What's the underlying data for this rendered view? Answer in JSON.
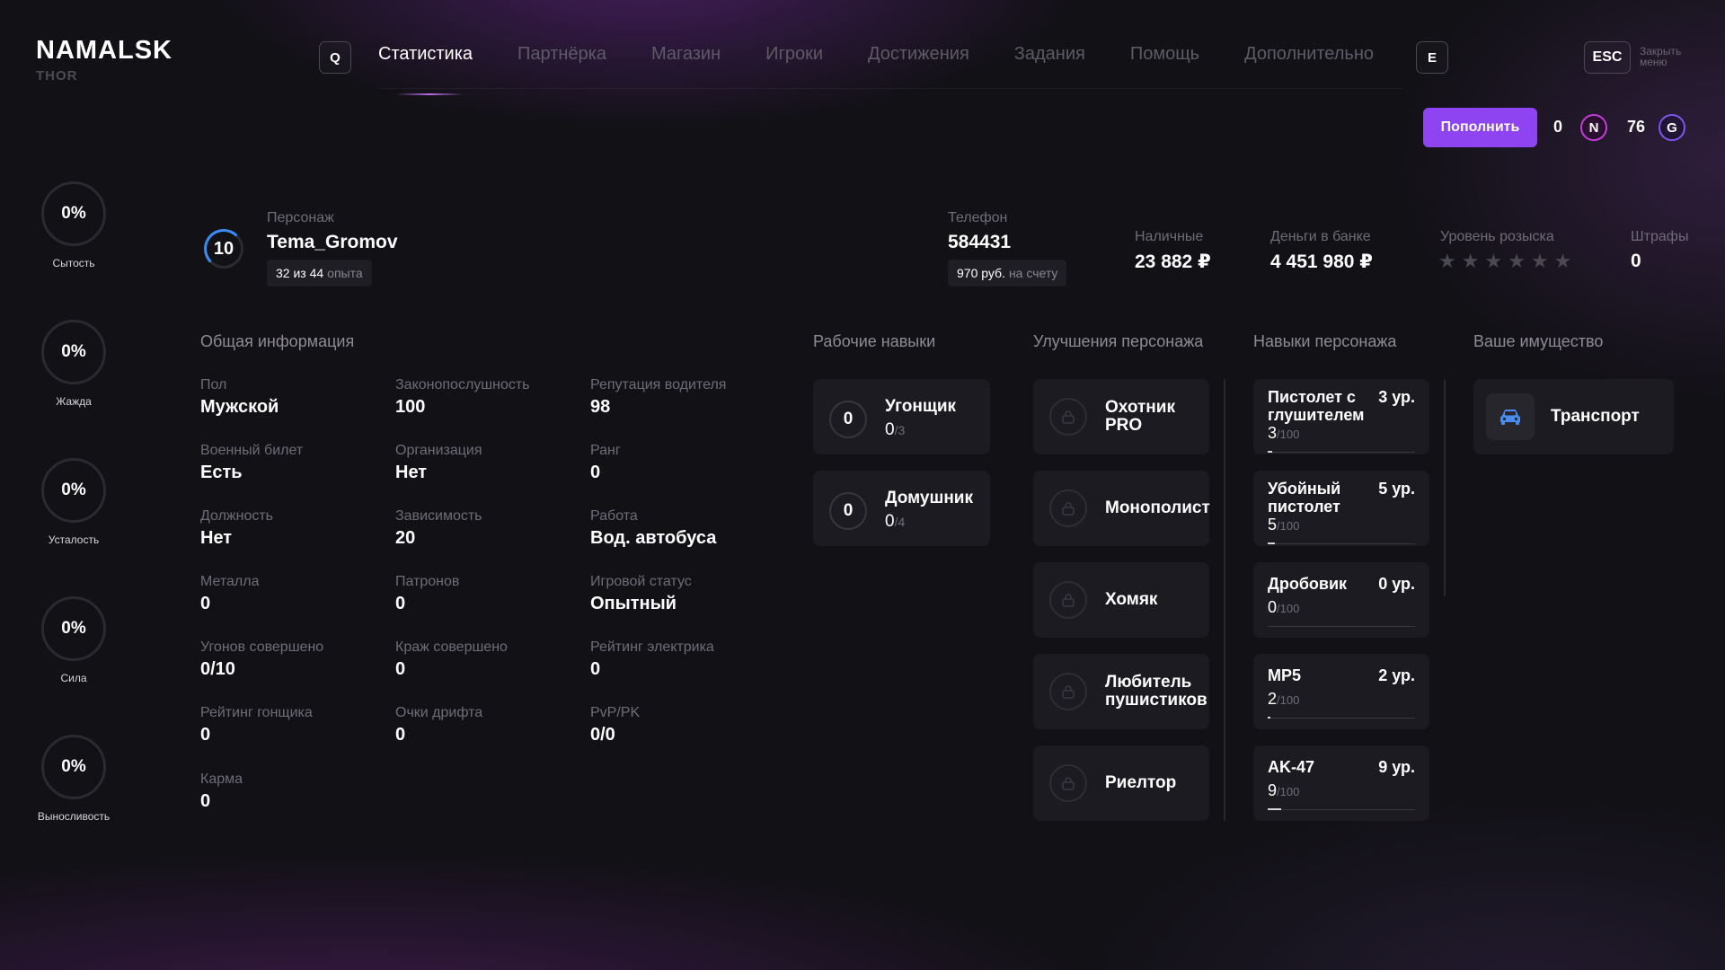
{
  "brand": {
    "title": "NAMALSK",
    "subtitle": "THOR"
  },
  "hotkeys": {
    "left": "Q",
    "right": "E",
    "esc": "ESC",
    "close_menu": "Закрыть меню"
  },
  "nav": [
    "Статистика",
    "Партнёрка",
    "Магазин",
    "Игроки",
    "Достижения",
    "Задания",
    "Помощь",
    "Дополнительно"
  ],
  "nav_active": 0,
  "wallet": {
    "topup_label": "Пополнить",
    "n_amount": "0",
    "n_symbol": "N",
    "g_amount": "76",
    "g_symbol": "G"
  },
  "needs": [
    {
      "value": "0%",
      "label": "Сытость"
    },
    {
      "value": "0%",
      "label": "Жажда"
    },
    {
      "value": "0%",
      "label": "Усталость"
    },
    {
      "value": "0%",
      "label": "Сила"
    },
    {
      "value": "0%",
      "label": "Выносливость"
    }
  ],
  "character": {
    "level": "10",
    "label": "Персонаж",
    "name": "Tema_Gromov",
    "exp_current": "32 из 44",
    "exp_word": "опыта"
  },
  "phone": {
    "label": "Телефон",
    "number": "584431",
    "balance": "970 руб.",
    "balance_suffix": "на счету"
  },
  "money": {
    "cash_label": "Наличные",
    "cash": "23 882 ₽",
    "bank_label": "Деньги в банке",
    "bank": "4 451 980 ₽",
    "wanted_label": "Уровень розыска",
    "wanted_level": 0,
    "wanted_max": 6,
    "fines_label": "Штрафы",
    "fines": "0"
  },
  "sections": {
    "general": "Общая информация",
    "work_skills": "Рабочие навыки",
    "upgrades": "Улучшения персонажа",
    "char_skills": "Навыки персонажа",
    "property": "Ваше имущество"
  },
  "general_info": [
    {
      "label": "Пол",
      "value": "Мужской"
    },
    {
      "label": "Законопослушность",
      "value": "100"
    },
    {
      "label": "Репутация водителя",
      "value": "98"
    },
    {
      "label": "Военный билет",
      "value": "Есть"
    },
    {
      "label": "Организация",
      "value": "Нет"
    },
    {
      "label": "Ранг",
      "value": "0"
    },
    {
      "label": "Должность",
      "value": "Нет"
    },
    {
      "label": "Зависимость",
      "value": "20"
    },
    {
      "label": "Работа",
      "value": "Вод. автобуса"
    },
    {
      "label": "Металла",
      "value": "0"
    },
    {
      "label": "Патронов",
      "value": "0"
    },
    {
      "label": "Игровой статус",
      "value": "Опытный"
    },
    {
      "label": "Угонов совершено",
      "value": "0/10"
    },
    {
      "label": "Краж совершено",
      "value": "0"
    },
    {
      "label": "Рейтинг электрика",
      "value": "0"
    },
    {
      "label": "Рейтинг гонщика",
      "value": "0"
    },
    {
      "label": "Очки дрифта",
      "value": "0"
    },
    {
      "label": "PvP/PK",
      "value": "0/0"
    },
    {
      "label": "Карма",
      "value": "0"
    }
  ],
  "work_skills": [
    {
      "level": "0",
      "name": "Угонщик",
      "progress": "0",
      "max": "/3"
    },
    {
      "level": "0",
      "name": "Домушник",
      "progress": "0",
      "max": "/4"
    }
  ],
  "upgrades": [
    {
      "name": "Охотник PRO"
    },
    {
      "name": "Монополист"
    },
    {
      "name": "Хомяк"
    },
    {
      "name": "Любитель пушистиков"
    },
    {
      "name": "Риелтор"
    }
  ],
  "char_skills": [
    {
      "name": "Пистолет с глушителем",
      "level": "3 ур.",
      "progress": "3",
      "max": "/100",
      "fraction": 0.03
    },
    {
      "name": "Убойный пистолет",
      "level": "5 ур.",
      "progress": "5",
      "max": "/100",
      "fraction": 0.05
    },
    {
      "name": "Дробовик",
      "level": "0 ур.",
      "progress": "0",
      "max": "/100",
      "fraction": 0
    },
    {
      "name": "MP5",
      "level": "2 ур.",
      "progress": "2",
      "max": "/100",
      "fraction": 0.02
    },
    {
      "name": "AK-47",
      "level": "9 ур.",
      "progress": "9",
      "max": "/100",
      "fraction": 0.09
    }
  ],
  "property": [
    {
      "name": "Транспорт",
      "icon": "car-icon",
      "icon_color": "#4a8cf0"
    }
  ],
  "colors": {
    "accent": "#8e44f0",
    "level_ring": "#3d8bf5",
    "coin_n": "#c23ed6",
    "coin_g": "#7e56f0"
  }
}
